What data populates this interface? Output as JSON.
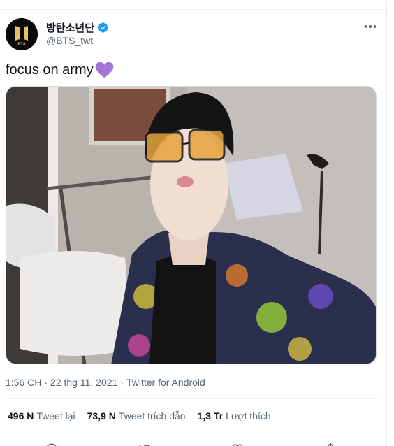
{
  "author": {
    "display_name": "방탄소년단",
    "handle": "@BTS_twt",
    "avatar_text": "BTS",
    "verified": true
  },
  "tweet": {
    "text": "focus on army",
    "emoji": "purple-heart-icon"
  },
  "meta": {
    "time": "1:56 CH",
    "separator1": "·",
    "date": "22 thg 11, 2021",
    "separator2": "·",
    "source": "Twitter for Android"
  },
  "stats": {
    "retweets_count": "496 N",
    "retweets_label": "Tweet lại",
    "quotes_count": "73,9 N",
    "quotes_label": "Tweet trích dẫn",
    "likes_count": "1,3 Tr",
    "likes_label": "Lượt thích"
  },
  "colors": {
    "text_primary": "#0f1419",
    "text_secondary": "#536471",
    "verified_blue": "#1d9bf0",
    "heart_purple": "#a475d6",
    "divider": "#eff3f4"
  },
  "actions": [
    "reply-icon",
    "retweet-icon",
    "like-icon",
    "share-icon"
  ]
}
